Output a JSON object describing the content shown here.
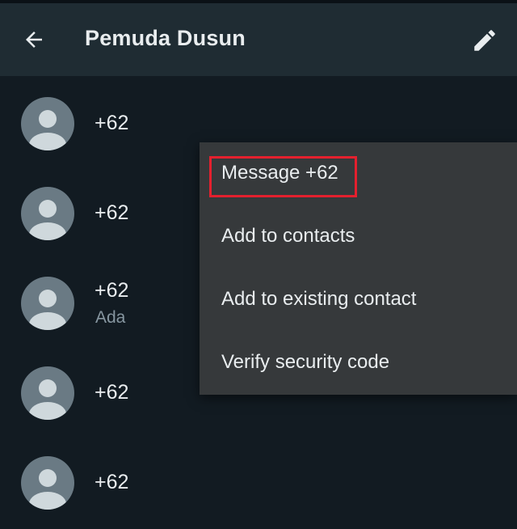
{
  "header": {
    "title": "Pemuda Dusun",
    "back_icon": "arrow-left-icon",
    "edit_icon": "pencil-icon"
  },
  "participants": [
    {
      "name": "+62",
      "status": ""
    },
    {
      "name": "+62",
      "status": ""
    },
    {
      "name": "+62",
      "status": "Ada"
    },
    {
      "name": "+62",
      "status": ""
    },
    {
      "name": "+62",
      "status": ""
    }
  ],
  "context_menu": {
    "items": [
      {
        "label": "Message +62",
        "highlighted": true
      },
      {
        "label": "Add to contacts",
        "highlighted": false
      },
      {
        "label": "Add to existing contact",
        "highlighted": false
      },
      {
        "label": "Verify security code",
        "highlighted": false
      }
    ]
  },
  "colors": {
    "background": "#121b22",
    "app_bar": "#1f2c33",
    "menu_background": "#36393b",
    "primary_text": "#e9edef",
    "secondary_text": "#8696a0",
    "avatar_background": "#6a7a84",
    "avatar_figure": "#cfd8dc",
    "highlight_border": "#e4202e"
  }
}
